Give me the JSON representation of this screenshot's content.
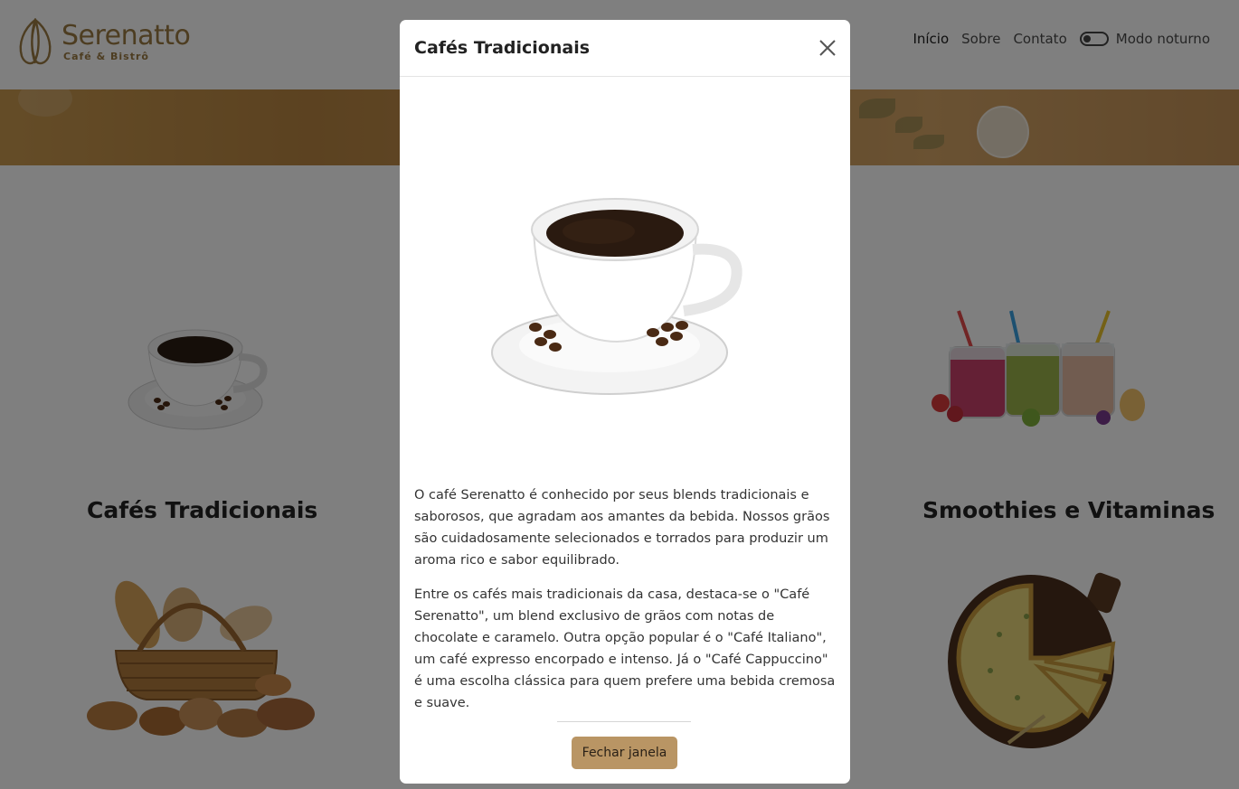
{
  "brand": {
    "name": "Serenatto",
    "tagline": "Café & Bistrô"
  },
  "nav": {
    "items": [
      {
        "label": "Início",
        "active": true
      },
      {
        "label": "Sobre",
        "active": false
      },
      {
        "label": "Contato",
        "active": false
      }
    ],
    "dark_mode_label": "Modo noturno",
    "dark_mode_on": false
  },
  "page": {
    "cards": [
      {
        "title": "Cafés Tradicionais",
        "image": "coffee-cup"
      },
      {
        "title": "Smoothies e Vitaminas",
        "image": "smoothie-jars"
      },
      {
        "title": "",
        "image": "bread-basket"
      },
      {
        "title": "",
        "image": "quiche"
      }
    ]
  },
  "modal": {
    "title": "Cafés Tradicionais",
    "close_icon": "close-icon",
    "paragraphs": [
      "O café Serenatto é conhecido por seus blends tradicionais e saborosos, que agradam aos amantes da bebida. Nossos grãos são cuidadosamente selecionados e torrados para produzir um aroma rico e sabor equilibrado.",
      "Entre os cafés mais tradicionais da casa, destaca-se o \"Café Serenatto\", um blend exclusivo de grãos com notas de chocolate e caramelo. Outra opção popular é o \"Café Italiano\", um café expresso encorpado e intenso. Já o \"Café Cappuccino\" é uma escolha clássica para quem prefere uma bebida cremosa e suave."
    ],
    "close_button_label": "Fechar janela"
  },
  "colors": {
    "brand": "#9b7a43",
    "button": "#b99564",
    "overlay": "rgba(0,0,0,0.5)"
  }
}
